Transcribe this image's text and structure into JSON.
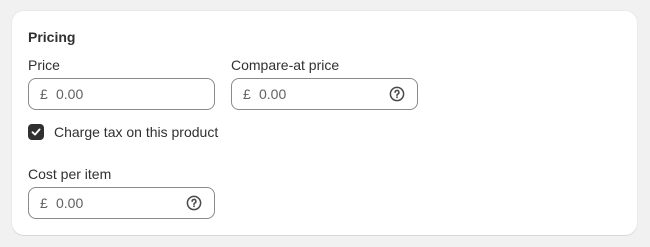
{
  "card": {
    "title": "Pricing"
  },
  "price": {
    "label": "Price",
    "currency_symbol": "£",
    "value": "0.00"
  },
  "compare_at_price": {
    "label": "Compare-at price",
    "currency_symbol": "£",
    "value": "0.00",
    "help_icon": "question-circle-icon"
  },
  "charge_tax": {
    "label": "Charge tax on this product",
    "checked": true
  },
  "cost_per_item": {
    "label": "Cost per item",
    "currency_symbol": "£",
    "value": "0.00",
    "help_icon": "question-circle-icon"
  },
  "colors": {
    "page_bg": "#f1f1f1",
    "card_bg": "#ffffff",
    "text": "#303030",
    "muted_text": "#616161",
    "field_border": "#8a8a8a",
    "checkbox_fill": "#303030"
  }
}
